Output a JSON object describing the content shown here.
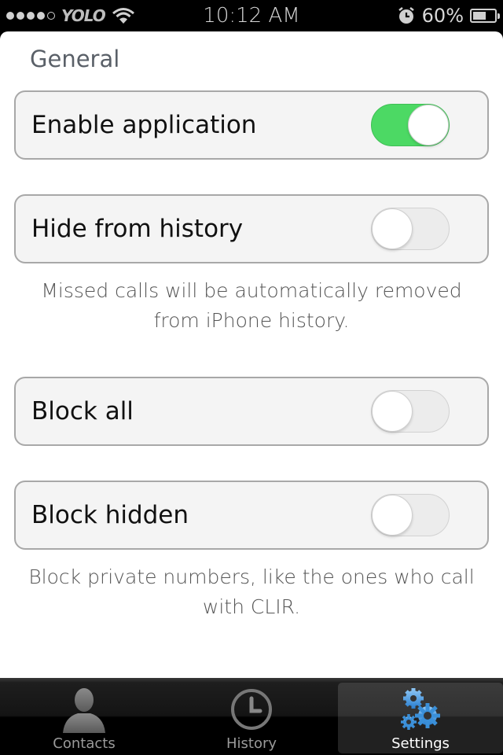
{
  "status_bar": {
    "carrier": "YOLO",
    "signal_bars_filled": 4,
    "signal_bars_total": 5,
    "time": "10:12 AM",
    "battery_percent_label": "60%",
    "battery_level": 0.6,
    "icons": [
      "signal-dots-icon",
      "wifi-icon",
      "alarm-icon",
      "battery-icon"
    ]
  },
  "section": {
    "title": "General"
  },
  "settings": [
    {
      "label": "Enable application",
      "enabled": true,
      "caption": ""
    },
    {
      "label": "Hide from history",
      "enabled": false,
      "caption": "Missed calls will be automatically removed from iPhone history."
    },
    {
      "label": "Block all",
      "enabled": false,
      "caption": ""
    },
    {
      "label": "Block hidden",
      "enabled": false,
      "caption": "Block private numbers, like the ones who call with CLIR."
    }
  ],
  "colors": {
    "toggle_on": "#4cd964",
    "toggle_off": "#ececec",
    "active_tab_icon": "#3a8fd8"
  },
  "tab_bar": {
    "tabs": [
      {
        "label": "Contacts",
        "icon": "person-icon",
        "active": false
      },
      {
        "label": "History",
        "icon": "clock-icon",
        "active": false
      },
      {
        "label": "Settings",
        "icon": "gears-icon",
        "active": true
      }
    ]
  }
}
